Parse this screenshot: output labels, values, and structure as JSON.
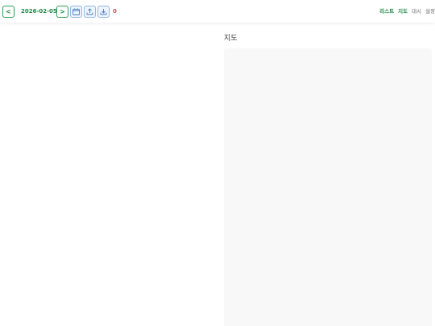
{
  "toolbar": {
    "prev_label": "<",
    "date": "2026-02-05",
    "next_label": ">",
    "calendar_icon": "calendar-icon",
    "upload_icon": "upload-icon",
    "download_icon": "download-icon",
    "count": "0"
  },
  "menu": {
    "items": [
      {
        "label": "리스트",
        "active": true
      },
      {
        "label": "지도",
        "active": true
      },
      {
        "label": "대시",
        "active": false
      },
      {
        "label": "설정",
        "active": false
      }
    ]
  },
  "main": {
    "map_title": "지도"
  },
  "colors": {
    "accent_green": "#1f8a47",
    "icon_blue": "#4a7fc1",
    "count_red": "#d9485f",
    "map_bg": "#f8f8f8"
  }
}
